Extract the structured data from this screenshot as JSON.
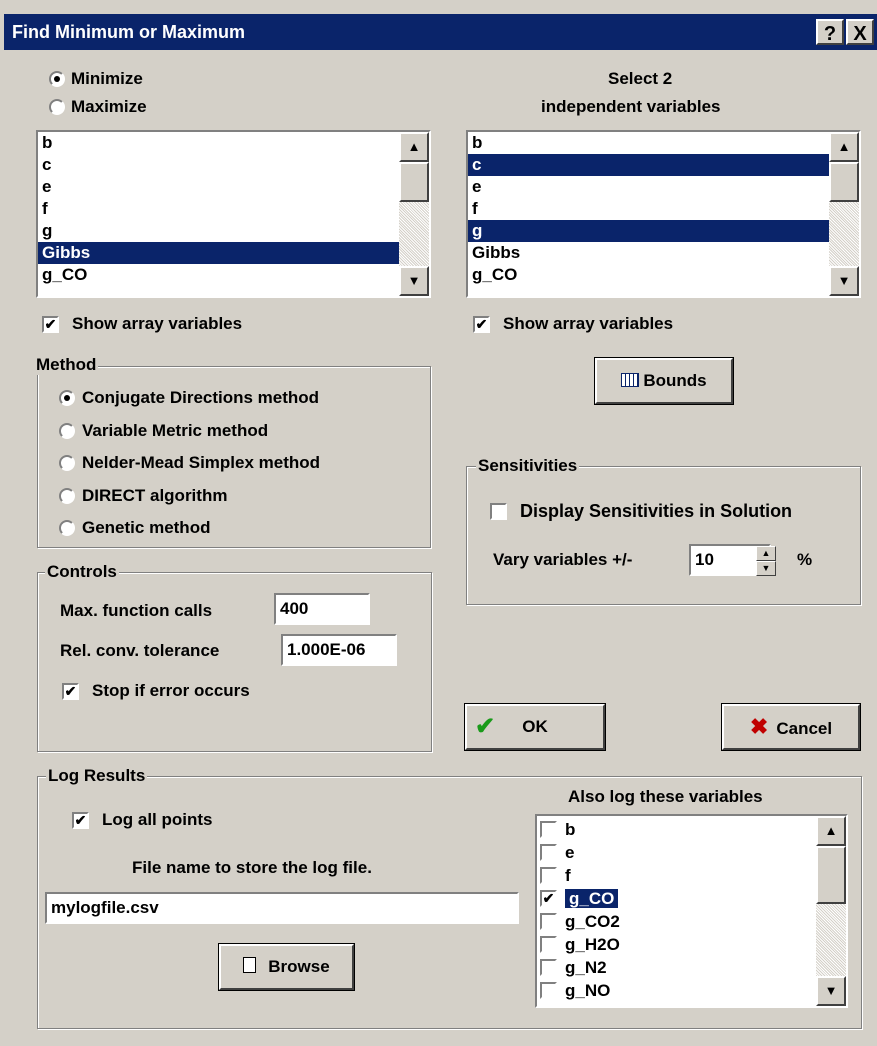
{
  "window": {
    "title": "Find Minimum or Maximum",
    "help_label": "?",
    "close_label": "X"
  },
  "objective": {
    "minimize_label": "Minimize",
    "maximize_label": "Maximize",
    "selected": "Minimize"
  },
  "left_list": {
    "items": [
      "b",
      "c",
      "e",
      "f",
      "g",
      "Gibbs",
      "g_CO"
    ],
    "selected": [
      "Gibbs"
    ],
    "show_array_label": "Show array variables",
    "show_array_checked": true
  },
  "right_list": {
    "heading_line1": "Select 2",
    "heading_line2": "independent variables",
    "items": [
      "b",
      "c",
      "e",
      "f",
      "g",
      "Gibbs",
      "g_CO"
    ],
    "selected": [
      "c",
      "g"
    ],
    "show_array_label": "Show array variables",
    "show_array_checked": true
  },
  "method": {
    "group_label": "Method",
    "options": [
      "Conjugate Directions method",
      "Variable Metric method",
      "Nelder-Mead Simplex method",
      "DIRECT algorithm",
      "Genetic method"
    ],
    "selected": "Conjugate Directions method"
  },
  "bounds": {
    "label": "Bounds",
    "icon": "table-icon"
  },
  "sensitivities": {
    "group_label": "Sensitivities",
    "display_label": "Display Sensitivities in Solution",
    "display_checked": false,
    "vary_label": "Vary variables +/-",
    "vary_value": "10",
    "unit": "%"
  },
  "controls": {
    "group_label": "Controls",
    "max_calls_label": "Max. function calls",
    "max_calls_value": "400",
    "tolerance_label": "Rel. conv. tolerance",
    "tolerance_value": "1.000E-06",
    "stop_label": "Stop if error occurs",
    "stop_checked": true
  },
  "buttons": {
    "ok_label": "OK",
    "cancel_label": "Cancel"
  },
  "log": {
    "group_label": "Log Results",
    "log_all_label": "Log all points",
    "log_all_checked": true,
    "file_prompt": "File name to store the log file.",
    "file_value": "mylogfile.csv",
    "browse_label": "Browse",
    "also_heading": "Also log these variables",
    "variables": [
      {
        "name": "b",
        "checked": false
      },
      {
        "name": "e",
        "checked": false
      },
      {
        "name": "f",
        "checked": false
      },
      {
        "name": "g_CO",
        "checked": true
      },
      {
        "name": "g_CO2",
        "checked": false
      },
      {
        "name": "g_H2O",
        "checked": false
      },
      {
        "name": "g_N2",
        "checked": false
      },
      {
        "name": "g_NO",
        "checked": false
      }
    ],
    "selected_variable": "g_CO"
  },
  "colors": {
    "titlebar": "#0a246a",
    "face": "#d4d0c8",
    "selection": "#0a246a",
    "ok_check": "#1a9a1a",
    "cancel_x": "#c00000"
  }
}
